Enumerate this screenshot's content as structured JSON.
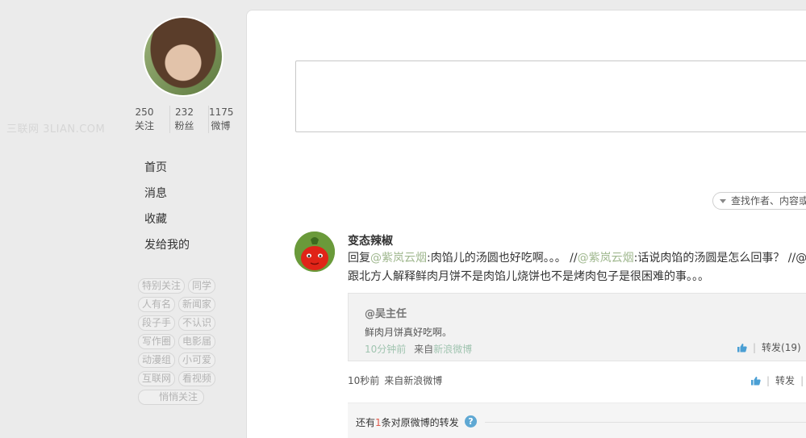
{
  "watermark": "三联网 3LIAN.COM",
  "profile": {
    "stats": [
      {
        "num": "250",
        "label": "关注"
      },
      {
        "num": "232",
        "label": "粉丝"
      },
      {
        "num": "1175",
        "label": "微博"
      }
    ]
  },
  "nav": [
    "首页",
    "消息",
    "收藏",
    "发给我的"
  ],
  "tags": [
    "特别关注",
    "同学",
    "人有名",
    "新闻家",
    "段子手",
    "不认识",
    "写作圈",
    "电影届",
    "动漫组",
    "小可爱",
    "互联网",
    "看视频",
    "悄悄关注"
  ],
  "search": {
    "label": "查找作者、内容或"
  },
  "post": {
    "author": "变态辣椒",
    "line1_a": "回复",
    "line1_at1": "@紫岚云烟",
    "line1_b": ":肉馅儿的汤圆也好吃啊。。。 //",
    "line1_at2": "@紫岚云烟",
    "line1_c": ":话说肉馅的汤圆是怎么回事？ //@",
    "line2": "跟北方人解释鲜肉月饼不是肉馅儿烧饼也不是烤肉包子是很困难的事。。。",
    "quote": {
      "name": "@吴主任",
      "text": "鲜肉月饼真好吃啊。",
      "time": "10分钟前",
      "from": "来自",
      "source": "新浪微博",
      "repost": "转发(19)"
    },
    "time": "10秒前",
    "source": "来自新浪微博",
    "repost": "转发"
  },
  "more": {
    "prefix": "还有",
    "count": "1",
    "suffix": "条对原微博的转发"
  },
  "colors": {
    "link": "#a0b88f",
    "accent": "#e05a4a",
    "help": "#5fa8d3"
  }
}
